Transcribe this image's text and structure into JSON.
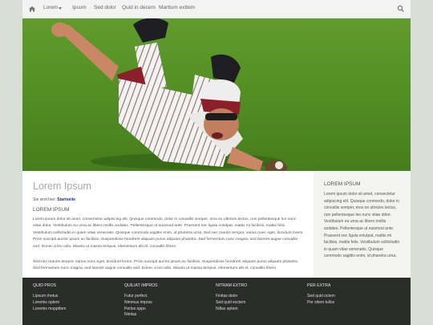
{
  "nav": {
    "items": [
      "Lorem",
      "Ipsum",
      "Sed dolor",
      "Quid in decem",
      "Marttum exttem"
    ]
  },
  "hero": {
    "image_description_icon": "baseball-player-diving-photo"
  },
  "main": {
    "title": "Lorem Ipsum",
    "breadcrumb_prefix": "Sie sind hier:",
    "breadcrumb_link": "Startseite",
    "section_heading": "LOREM IPSUM",
    "paragraph1": "Lorem ipsum dolor sit amet, consectetur adipiscing elit. Quisque commodo, dolor in convallis semper, eros ex ultricies lectus, non pellentesque leo nunc vitae dolor. Vestibulum eu urna ac libero mollis sodales. Pellentesque ut euismod ante. Praesent nec ligula volutpat, mattis mi facilisis, mattis felis. Vestibulum sollicitudin in quam vitae venenatis. Quisque commodo sagittis enim, id pharetra urna. Sed nec mauris tempor, varius nunc eget, tincidunt lorem. Proin suscipit auctor ipsum ac facilisis. Suspendisse hendrerit aliquam purus aliquam pharetra. Sed fermentum nunc magna, sed laoreet augue convallis sed. Donec a leo odio. Mauris ut massa tempus, elementum elit et, convallis libero.",
    "paragraph2": "Sed nec mauris tempor, varius nunc eget, tincidunt lorem. Proin suscipit auctor ipsum ac facilisis. Suspendisse hendrerit aliquam purus aliquam pharetra. Sed fermentum nunc magna, sed laoreet augue convallis sed. Donec a leo odio. Mauris ut massa tempus, elementum elit et, convallis libero."
  },
  "sidebar": {
    "heading": "LOREM IPSUM",
    "text": "Lorem ipsum dolor sit amet, consectetur adipiscing elit. Quisque commodo, dolor in convallis semper, eros ex ultricies lectus, non pellentesque leo nunc vitae dolor. Vestibulum eu urna ac libero mollis sodales. Pellentesque ut euismod ante. Praesent nec ligula volutpat, mattis mi facilisis, mattis felis. Vestibulum sollicitudin in quam vitae venenatis. Quisque commodo sagittis enim, id pharetra urna."
  },
  "footer": {
    "columns": [
      {
        "heading": "QUID PROS",
        "links": [
          "Lipsum rhetus",
          "Loremis optem",
          "Loremix moppttem"
        ]
      },
      {
        "heading": "QUILIAT IMPROS",
        "links": [
          "Futur perfect",
          "Nimmus impras",
          "Perlox oppo",
          "Nimlas"
        ]
      },
      {
        "heading": "NITRAM EXTRO",
        "links": [
          "Finitas dolor",
          "Sed quid exctem",
          "Nillas optem"
        ]
      },
      {
        "heading": "PER EXTRA",
        "links": [
          "Sed quid octem",
          "Per sitem tullos"
        ]
      }
    ]
  },
  "colors": {
    "background": "#d8ddd6",
    "nav_bg": "#f3f3f3",
    "sidebar_bg": "#f3f4f0",
    "footer_bg": "#2b2d2b",
    "link_blue": "#1a2f8f",
    "title_gray": "#a8a8a8"
  }
}
